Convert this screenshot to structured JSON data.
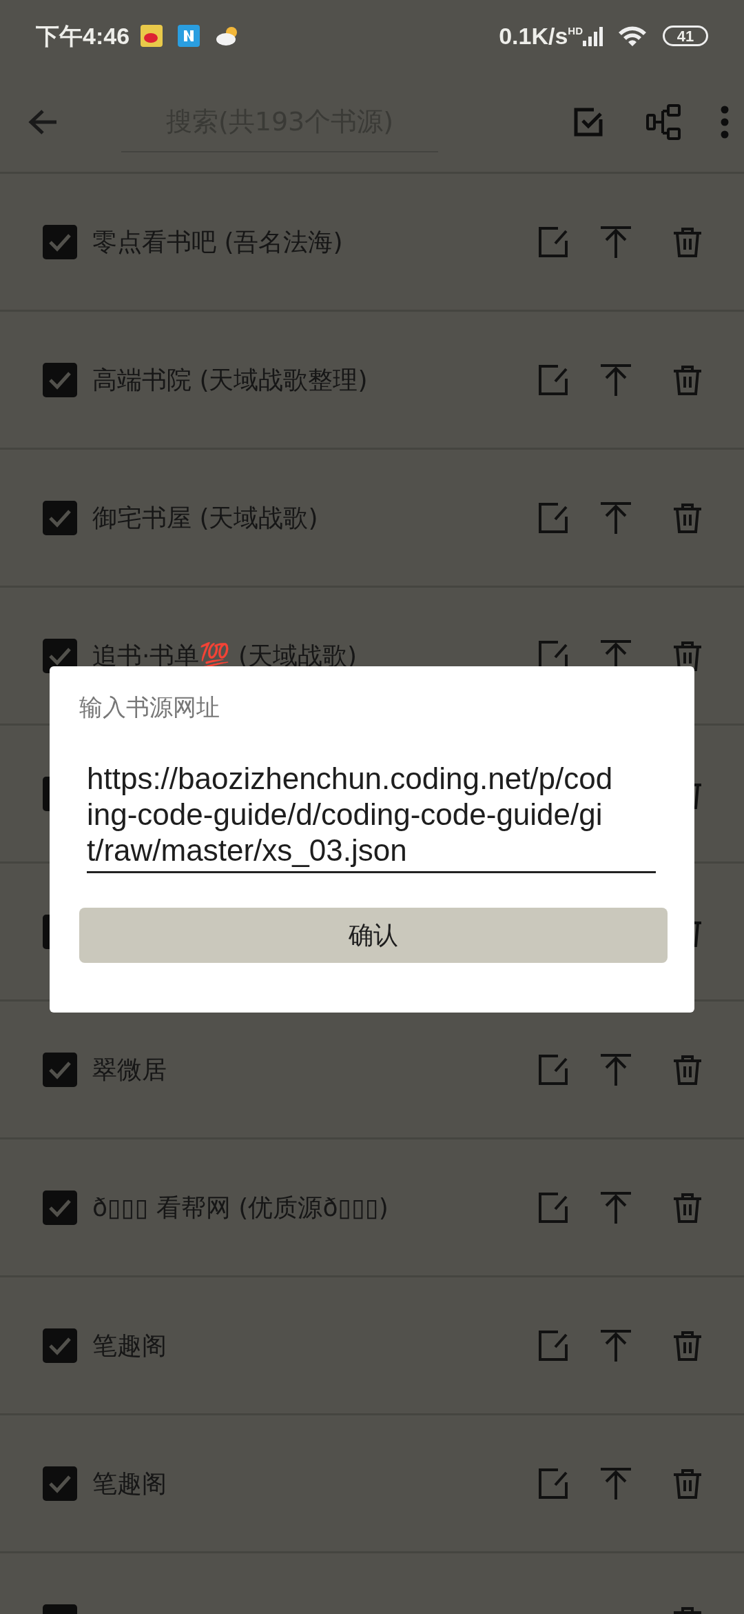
{
  "status_bar": {
    "time": "下午4:46",
    "net_speed": "0.1K/s",
    "network_badge": "HD",
    "battery": "41"
  },
  "toolbar": {
    "search": {
      "placeholder": "搜索(共193个书源)"
    }
  },
  "sources": [
    {
      "name": "零点看书吧 (吾名法海)",
      "checked": true
    },
    {
      "name": "高端书院 (天域战歌整理)",
      "checked": true
    },
    {
      "name": "御宅书屋 (天域战歌)",
      "checked": true
    },
    {
      "name": "追书·书单💯 (天域战歌)",
      "checked": true
    },
    {
      "checked": true
    },
    {
      "checked": true
    },
    {
      "name": "翠微居",
      "checked": true
    },
    {
      "name": "ð▯▯▯ 看帮网 (优质源ð▯▯▯)",
      "checked": true
    },
    {
      "name": "笔趣阁",
      "checked": true
    },
    {
      "name": "笔趣阁",
      "checked": true
    },
    {
      "checked": true
    }
  ],
  "dialog": {
    "title": "输入书源网址",
    "value": "https://baozizhenchun.coding.net/p/coding-code-guide/d/coding-code-guide/git/raw/master/xs_03.json",
    "confirm": "确认"
  }
}
